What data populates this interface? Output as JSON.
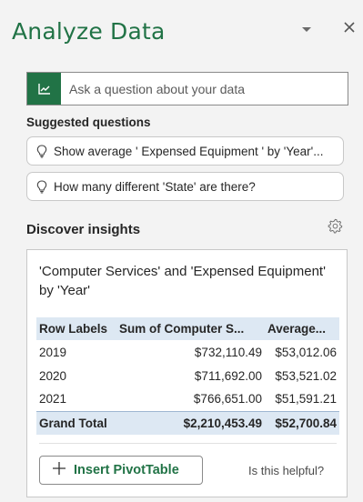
{
  "pane": {
    "title": "Analyze Data",
    "accent_color": "#217346",
    "header_icons": [
      "chevron-down-icon",
      "close-icon"
    ]
  },
  "ask": {
    "placeholder": "Ask a question about your data",
    "icon": "chart-icon"
  },
  "suggested": {
    "heading": "Suggested questions",
    "items": [
      {
        "icon": "lightbulb-icon",
        "label": "Show average ' Expensed Equipment ' by 'Year'..."
      },
      {
        "icon": "lightbulb-icon",
        "label": "How many different 'State' are there?"
      }
    ]
  },
  "insights": {
    "heading": "Discover insights",
    "settings_icon": "gear-icon",
    "card": {
      "title": "'Computer Services' and 'Expensed Equipment' by 'Year'",
      "table": {
        "headers": [
          "Row Labels",
          "Sum of Computer S...",
          "Average..."
        ],
        "rows": [
          [
            "2019",
            "$732,110.49",
            "$53,012.06"
          ],
          [
            "2020",
            "$711,692.00",
            "$53,521.02"
          ],
          [
            "2021",
            "$766,651.00",
            "$51,591.21"
          ]
        ],
        "total": [
          "Grand Total",
          "$2,210,453.49",
          "$52,700.84"
        ],
        "header_bg": "#dde8f3"
      },
      "insert_button": {
        "icon": "plus-icon",
        "label": "Insert PivotTable"
      },
      "helpful_link": "Is this helpful?"
    }
  }
}
